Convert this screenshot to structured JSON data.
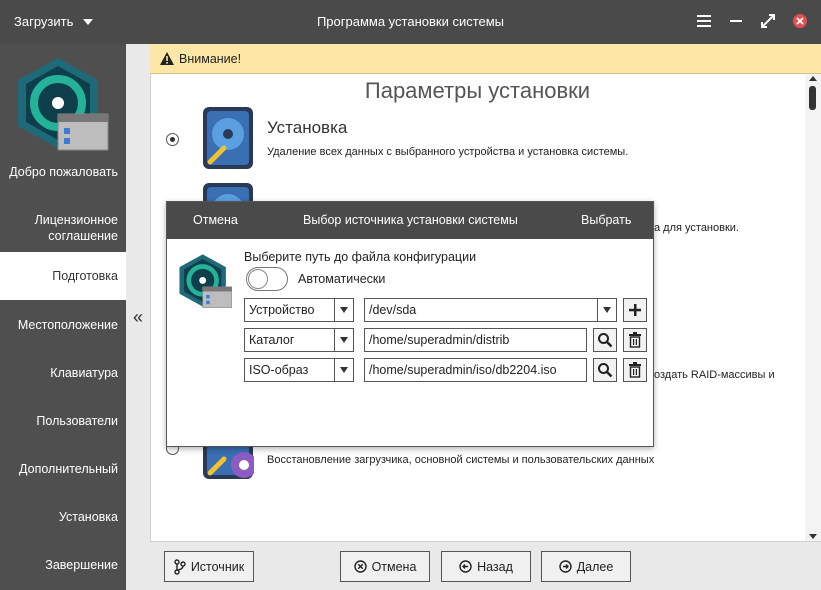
{
  "window": {
    "menu_label": "Загрузить",
    "title": "Программа установки системы"
  },
  "sidebar": {
    "items": [
      {
        "label": "Добро пожаловать"
      },
      {
        "label": "Лицензионное соглашение"
      },
      {
        "label": "Подготовка"
      },
      {
        "label": "Местоположение"
      },
      {
        "label": "Клавиатура"
      },
      {
        "label": "Пользователи"
      },
      {
        "label": "Дополнительный"
      },
      {
        "label": "Установка"
      },
      {
        "label": "Завершение"
      }
    ],
    "active_index": 2,
    "collapse_glyph": "«"
  },
  "warning": {
    "text": "Внимание!"
  },
  "main": {
    "title": "Параметры установки",
    "options": [
      {
        "title": "Установка",
        "description": "Удаление всех данных с выбранного устройства и установка системы."
      },
      {
        "title": "",
        "description": "а для установки."
      },
      {
        "title": "",
        "description": "оздать RAID-массивы и"
      },
      {
        "title": "",
        "description": "Восстановление загрузчика, основной системы и пользовательских данных"
      }
    ]
  },
  "dialog": {
    "cancel_label": "Отмена",
    "title": "Выбор источника установки системы",
    "select_label": "Выбрать",
    "path_label": "Выберите путь до файла конфигурации",
    "auto_label": "Автоматически",
    "auto_enabled": false,
    "rows": [
      {
        "type": "Устройство",
        "path": "/dev/sda"
      },
      {
        "type": "Каталог",
        "path": "/home/superadmin/distrib"
      },
      {
        "type": "ISO-образ",
        "path": "/home/superadmin/iso/db2204.iso"
      }
    ]
  },
  "toolbar": {
    "source_label": "Источник",
    "cancel_label": "Отмена",
    "back_label": "Назад",
    "next_label": "Далее"
  },
  "colors": {
    "titlebar": "#4a4a4a",
    "sidebar": "#4f4f4f",
    "warning_bg": "#fde7a6",
    "accent_teal": "#1a9e8f",
    "close_red": "#e05050"
  }
}
